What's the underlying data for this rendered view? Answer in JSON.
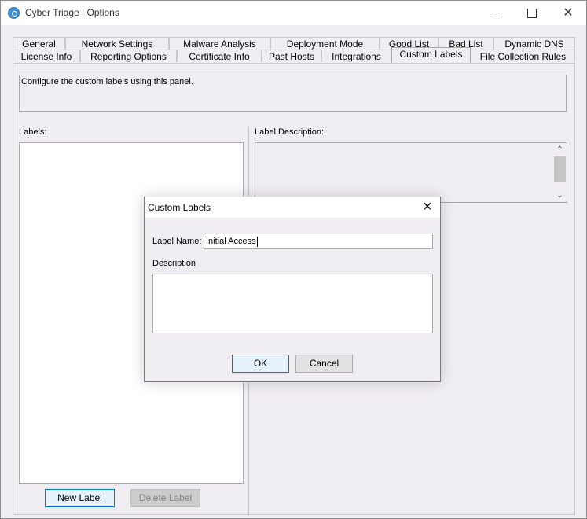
{
  "window": {
    "title": "Cyber Triage | Options",
    "controls": {
      "minimize": "—",
      "maximize": "",
      "close": "✕"
    }
  },
  "tabs": {
    "row1": [
      "General",
      "Network Settings",
      "Malware Analysis",
      "Deployment Mode",
      "Good List",
      "Bad List",
      "Dynamic DNS"
    ],
    "row2": [
      "License Info",
      "Reporting Options",
      "Certificate Info",
      "Past Hosts",
      "Integrations",
      "Custom Labels",
      "File Collection Rules"
    ],
    "active": "Custom Labels"
  },
  "panel": {
    "info_text": "Configure the custom labels using this panel.",
    "labels_heading": "Labels:",
    "description_heading": "Label Description:",
    "new_label_button": "New Label",
    "delete_label_button": "Delete Label"
  },
  "dialog": {
    "title": "Custom Labels",
    "close": "✕",
    "label_name_label": "Label Name:",
    "label_name_value": "Initial Access",
    "description_label": "Description",
    "ok_button": "OK",
    "cancel_button": "Cancel"
  },
  "scrollbar": {
    "up": "⌃",
    "down": "⌄"
  },
  "colors": {
    "window_bg": "#f1eef3",
    "primary_button_border": "#0078d7",
    "primary_button_bg": "#e5f1fb"
  }
}
